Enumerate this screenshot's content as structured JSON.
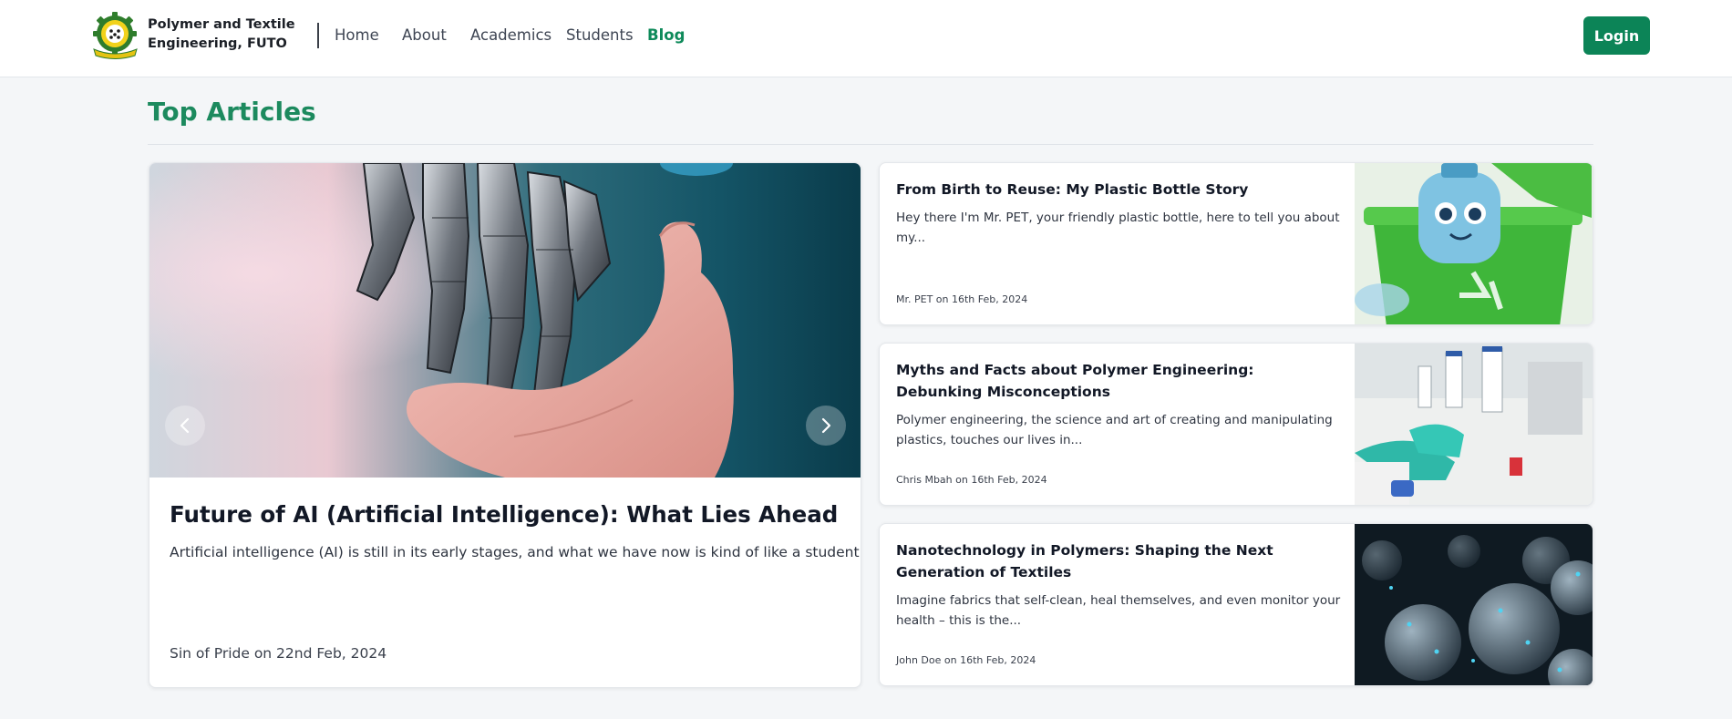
{
  "brand": {
    "name_line1": "Polymer and Textile",
    "name_line2": "Engineering, FUTO"
  },
  "nav": {
    "items": [
      {
        "label": "Home"
      },
      {
        "label": "About"
      },
      {
        "label": "Academics"
      },
      {
        "label": "Students"
      },
      {
        "label": "Blog",
        "active": true
      }
    ],
    "login_label": "Login"
  },
  "section": {
    "title": "Top Articles"
  },
  "featured": {
    "title": "Future of AI (Artificial Intelligence): What Lies Ahead",
    "excerpt": "Artificial intelligence (AI) is still in its early stages, and what we have now is kind of like a student...",
    "meta": "Sin of Pride on 22nd Feb, 2024",
    "prev_icon": "chevron-left-icon",
    "next_icon": "chevron-right-icon"
  },
  "articles": [
    {
      "title": "From Birth to Reuse: My Plastic Bottle Story",
      "excerpt": "Hey there I'm Mr. PET, your friendly plastic bottle, here to tell you about my...",
      "meta": "Mr. PET on 16th Feb, 2024"
    },
    {
      "title": "Myths and Facts about Polymer Engineering: Debunking Misconceptions",
      "excerpt": "Polymer engineering, the science and art of creating and manipulating plastics, touches our lives in...",
      "meta": "Chris Mbah on 16th Feb, 2024"
    },
    {
      "title": "Nanotechnology in Polymers: Shaping the Next Generation of Textiles",
      "excerpt": "Imagine fabrics that self-clean, heal themselves, and even monitor your health – this is the...",
      "meta": "John Doe on 16th Feb, 2024"
    }
  ],
  "colors": {
    "accent": "#0c8457",
    "title_green": "#1c8a5e",
    "background": "#f4f6f8"
  }
}
